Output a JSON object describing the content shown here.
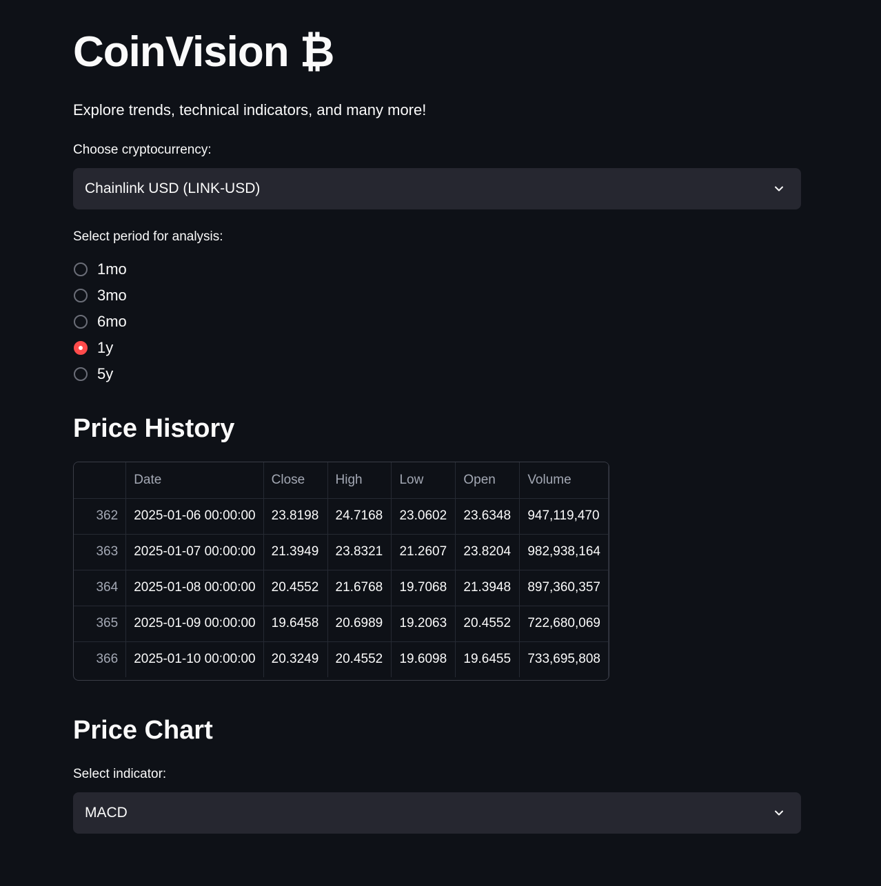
{
  "app": {
    "title": "CoinVision",
    "title_icon": "₿",
    "subtitle": "Explore trends, technical indicators, and many more!"
  },
  "crypto_select": {
    "label": "Choose cryptocurrency:",
    "value": "Chainlink USD (LINK-USD)"
  },
  "period": {
    "label": "Select period for analysis:",
    "options": [
      "1mo",
      "3mo",
      "6mo",
      "1y",
      "5y"
    ],
    "selected": "1y"
  },
  "price_history": {
    "heading": "Price History",
    "columns": [
      "",
      "Date",
      "Close",
      "High",
      "Low",
      "Open",
      "Volume"
    ],
    "rows": [
      [
        "362",
        "2025-01-06 00:00:00",
        "23.8198",
        "24.7168",
        "23.0602",
        "23.6348",
        "947,119,470"
      ],
      [
        "363",
        "2025-01-07 00:00:00",
        "21.3949",
        "23.8321",
        "21.2607",
        "23.8204",
        "982,938,164"
      ],
      [
        "364",
        "2025-01-08 00:00:00",
        "20.4552",
        "21.6768",
        "19.7068",
        "21.3948",
        "897,360,357"
      ],
      [
        "365",
        "2025-01-09 00:00:00",
        "19.6458",
        "20.6989",
        "19.2063",
        "20.4552",
        "722,680,069"
      ],
      [
        "366",
        "2025-01-10 00:00:00",
        "20.3249",
        "20.4552",
        "19.6098",
        "19.6455",
        "733,695,808"
      ]
    ]
  },
  "price_chart": {
    "heading": "Price Chart",
    "indicator_label": "Select indicator:",
    "indicator_value": "MACD"
  },
  "colors": {
    "background": "#0e1117",
    "accent": "#ff4b4b",
    "input_bg": "#262730"
  }
}
